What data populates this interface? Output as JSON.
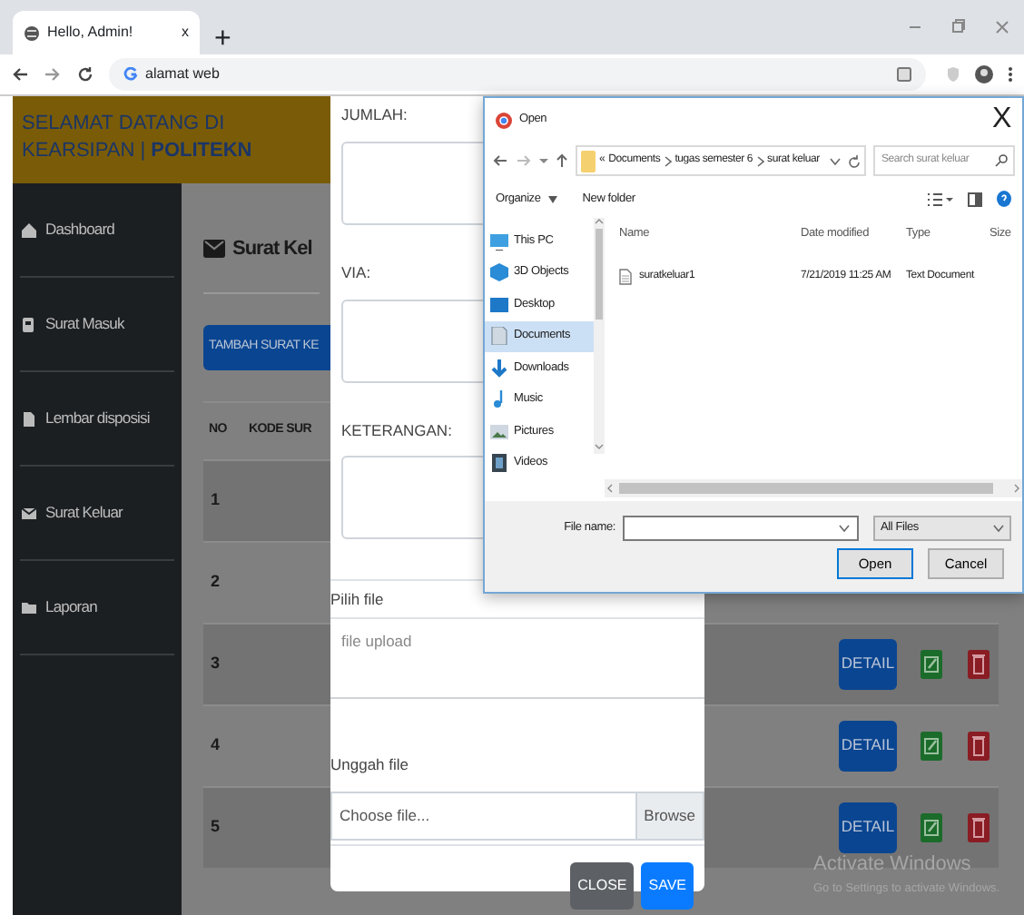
{
  "browser": {
    "tab_title": "Hello, Admin!",
    "tab_close": "x",
    "new_tab": "+",
    "address": "alamat web"
  },
  "header": {
    "text": "SELAMAT DATANG DI KEARSIPAN | **POLITEKN**"
  },
  "sidebar": {
    "items": [
      {
        "label": "Dashboard"
      },
      {
        "label": "Surat Masuk"
      },
      {
        "label": "Lembar disposisi"
      },
      {
        "label": "Surat Keluar"
      },
      {
        "label": "Laporan"
      }
    ]
  },
  "page": {
    "title": "Surat Kel",
    "add_button": "TAMBAH SURAT KE"
  },
  "table": {
    "columns": [
      "NO",
      "KODE SUR"
    ],
    "rows": [
      {
        "no": "1"
      },
      {
        "no": "2"
      },
      {
        "no": "3",
        "detail": "DETAIL"
      },
      {
        "no": "4",
        "detail": "DETAIL"
      },
      {
        "no": "5",
        "detail": "DETAIL"
      }
    ]
  },
  "modal": {
    "fields": [
      {
        "label": "JUMLAH:",
        "kind": "textarea"
      },
      {
        "label": "VIA:",
        "kind": "textarea"
      },
      {
        "label": "KETERANGAN:",
        "kind": "textarea"
      },
      {
        "label": "Pilih file",
        "kind": "boxed-textarea",
        "placeholder": "file upload"
      },
      {
        "label": "Unggah file",
        "kind": "file",
        "placeholder": "Choose file...",
        "button": "Browse"
      }
    ],
    "buttons": [
      {
        "label": "CLOSE",
        "kind": "secondary"
      },
      {
        "label": "SAVE",
        "kind": "primary"
      }
    ]
  },
  "file_dialog": {
    "title": "Open",
    "close": "X",
    "path_prefix": "«",
    "path": [
      "Documents",
      "tugas semester 6",
      "surat keluar"
    ],
    "search": {
      "placeholder": "Search surat keluar"
    },
    "toolbar": [
      "Organize",
      "New folder"
    ],
    "nav": [
      {
        "label": "This PC",
        "selected": false
      },
      {
        "label": "3D Objects",
        "selected": false
      },
      {
        "label": "Desktop",
        "selected": false
      },
      {
        "label": "Documents",
        "selected": true
      },
      {
        "label": "Downloads",
        "selected": false
      },
      {
        "label": "Music",
        "selected": false
      },
      {
        "label": "Pictures",
        "selected": false
      },
      {
        "label": "Videos",
        "selected": false
      }
    ],
    "columns": [
      "Name",
      "Date modified",
      "Type",
      "Size"
    ],
    "files": [
      {
        "name": "suratkeluar1",
        "date": "7/21/2019 11:25 AM",
        "type": "Text Document"
      }
    ],
    "file_name_label": "File name:",
    "file_type": "All Files",
    "buttons": [
      "Open",
      "Cancel"
    ]
  },
  "activation_notice": {
    "title": "Activate Windows",
    "subtitle": "Go to Settings to activate Windows."
  }
}
